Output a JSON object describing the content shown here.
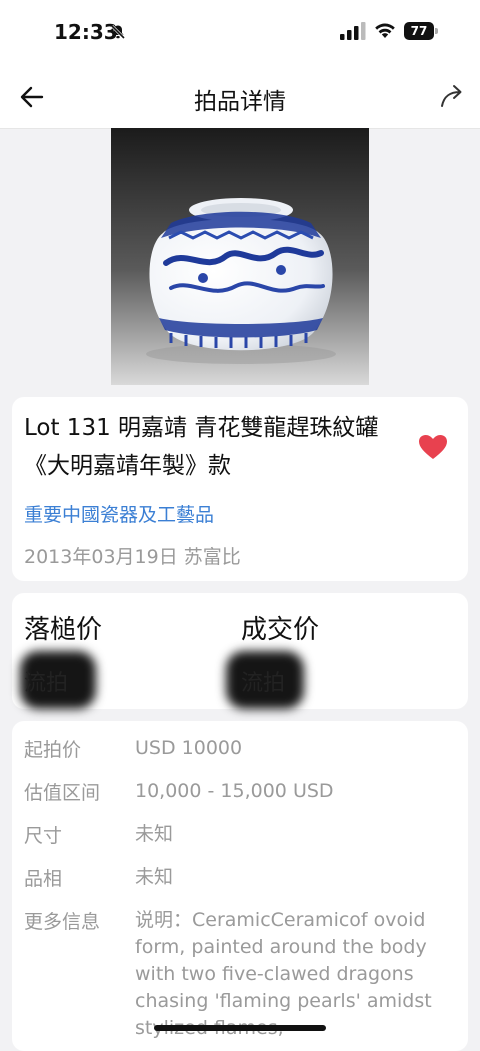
{
  "status_bar": {
    "time": "12:33",
    "battery": "77"
  },
  "nav": {
    "title": "拍品详情"
  },
  "lot": {
    "title": "Lot 131 明嘉靖 青花雙龍趕珠紋罐 《大明嘉靖年製》款",
    "category": "重要中國瓷器及工藝品",
    "date_house": "2013年03月19日 苏富比",
    "favorited": true
  },
  "prices": {
    "hammer_label": "落槌价",
    "hammer_value": "流拍",
    "deal_label": "成交价",
    "deal_value": "流拍"
  },
  "details": {
    "start_label": "起拍价",
    "start_value": "USD 10000",
    "estimate_label": "估值区间",
    "estimate_value": "10,000 - 15,000 USD",
    "size_label": "尺寸",
    "size_value": "未知",
    "condition_label": "品相",
    "condition_value": "未知",
    "more_label": "更多信息",
    "more_value": "说明：CeramicCeramicof ovoid form, painted around the body with two five-clawed dragons chasing 'flaming pearls' amidst stylized flames,"
  },
  "colors": {
    "accent": "#3b7fd4",
    "heart": "#e8414f"
  }
}
